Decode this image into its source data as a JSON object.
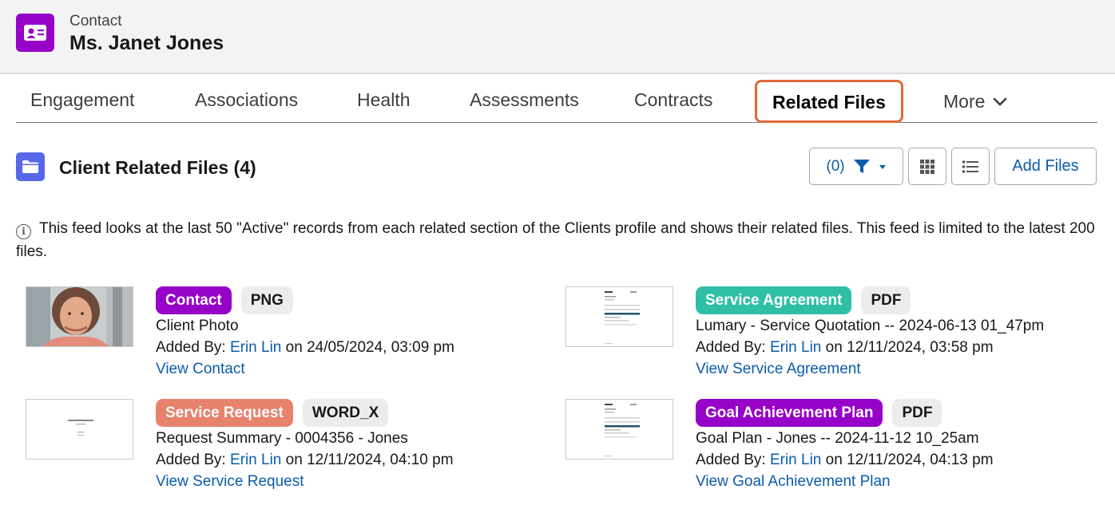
{
  "header": {
    "object_label": "Contact",
    "record_name": "Ms. Janet Jones",
    "icon": "contact-card-icon",
    "icon_color": "#9602c7"
  },
  "tabs": [
    {
      "label": "Engagement"
    },
    {
      "label": "Associations"
    },
    {
      "label": "Health"
    },
    {
      "label": "Assessments"
    },
    {
      "label": "Contracts"
    },
    {
      "label": "Related Files",
      "active": true
    },
    {
      "label": "More"
    }
  ],
  "section": {
    "title": "Client Related Files (4)",
    "icon": "folder-icon",
    "filter_label": "(0)",
    "add_files_label": "Add Files"
  },
  "info_text": "This feed looks at the last 50 \"Active\" records from each related section of the Clients profile and shows their related files. This feed is limited to the latest 200 files.",
  "files": [
    {
      "category": "Contact",
      "category_color": "#9602c7",
      "file_type": "PNG",
      "title": "Client Photo",
      "added_by_prefix": "Added By:",
      "added_by": "Erin Lin",
      "added_on": "on 24/05/2024, 03:09 pm",
      "view_link": "View Contact"
    },
    {
      "category": "Service Agreement",
      "category_color": "#2fbfa6",
      "file_type": "PDF",
      "title": "Lumary - Service Quotation -- 2024-06-13 01_47pm",
      "added_by_prefix": "Added By:",
      "added_by": "Erin Lin",
      "added_on": "on 12/11/2024, 03:58 pm",
      "view_link": "View Service Agreement"
    },
    {
      "category": "Service Request",
      "category_color": "#e7826d",
      "file_type": "WORD_X",
      "title": "Request Summary - 0004356 - Jones",
      "added_by_prefix": "Added By:",
      "added_by": "Erin Lin",
      "added_on": "on 12/11/2024, 04:10 pm",
      "view_link": "View Service Request"
    },
    {
      "category": "Goal Achievement Plan",
      "category_color": "#9602c7",
      "file_type": "PDF",
      "title": "Goal Plan - Jones -- 2024-11-12 10_25am",
      "added_by_prefix": "Added By:",
      "added_by": "Erin Lin",
      "added_on": "on 12/11/2024, 04:13 pm",
      "view_link": "View Goal Achievement Plan"
    }
  ]
}
